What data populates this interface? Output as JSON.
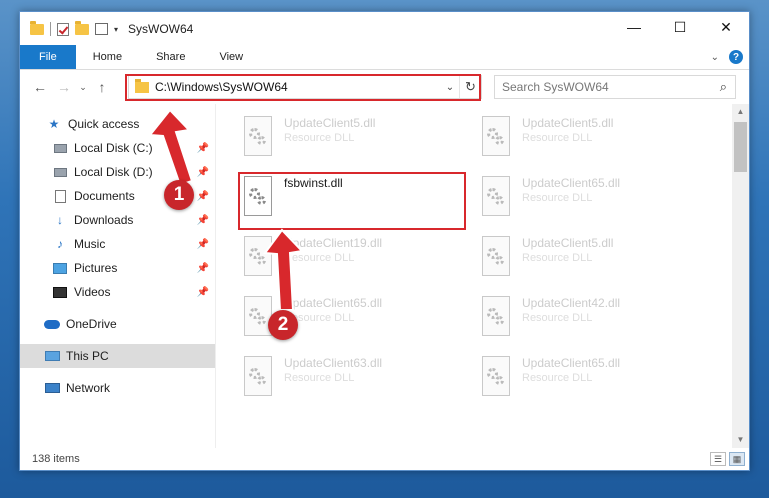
{
  "window": {
    "title": "SysWOW64",
    "controls": [
      "—",
      "☐",
      "✕"
    ]
  },
  "ribbon": {
    "tabs": [
      "File",
      "Home",
      "Share",
      "View"
    ],
    "help": "?"
  },
  "address": {
    "path": "C:\\Windows\\SysWOW64",
    "search_placeholder": "Search SysWOW64"
  },
  "nav": {
    "items": [
      {
        "label": "Quick access",
        "icon": "star-icon"
      },
      {
        "label": "Local Disk (C:)",
        "icon": "drive-icon"
      },
      {
        "label": "Local Disk (D:)",
        "icon": "drive-icon"
      },
      {
        "label": "Documents",
        "icon": "documents-icon"
      },
      {
        "label": "Downloads",
        "icon": "download-icon"
      },
      {
        "label": "Music",
        "icon": "music-icon"
      },
      {
        "label": "Pictures",
        "icon": "pictures-icon"
      },
      {
        "label": "Videos",
        "icon": "videos-icon"
      },
      {
        "label": "OneDrive",
        "icon": "cloud-icon"
      },
      {
        "label": "This PC",
        "icon": "computer-icon"
      },
      {
        "label": "Network",
        "icon": "network-icon"
      }
    ]
  },
  "files": [
    {
      "name": "UpdateClient5.dll",
      "type": "Resource DLL"
    },
    {
      "name": "UpdateClient5.dll",
      "type": "Resource DLL"
    },
    {
      "name": "fsbwinst.dll",
      "type": ""
    },
    {
      "name": "UpdateClient65.dll",
      "type": "Resource DLL"
    },
    {
      "name": "UpdateClient19.dll",
      "type": "Resource DLL"
    },
    {
      "name": "UpdateClient5.dll",
      "type": "Resource DLL"
    },
    {
      "name": "UpdateClient65.dll",
      "type": "Resource DLL"
    },
    {
      "name": "UpdateClient42.dll",
      "type": "Resource DLL"
    },
    {
      "name": "UpdateClient63.dll",
      "type": "Resource DLL"
    },
    {
      "name": "UpdateClient65.dll",
      "type": "Resource DLL"
    }
  ],
  "status": {
    "count": "138 items"
  },
  "annotations": {
    "badge1": "1",
    "badge2": "2",
    "color": "#d8282c"
  }
}
